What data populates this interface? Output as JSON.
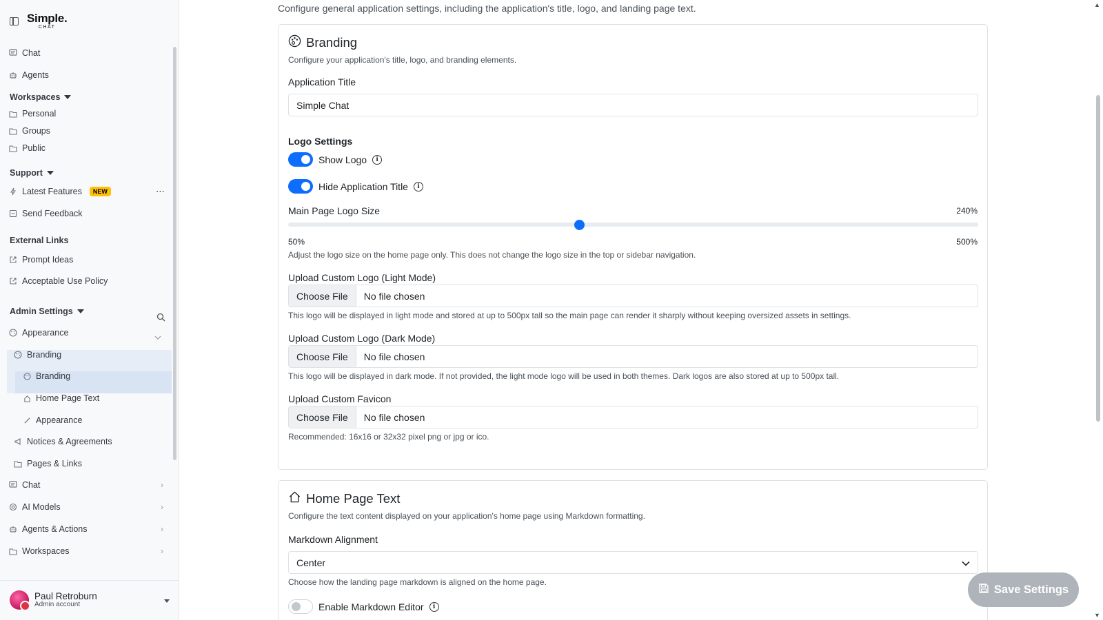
{
  "app": {
    "logo_line1": "Simple.",
    "logo_line2": "CHAT"
  },
  "sidebar": {
    "chat": "Chat",
    "agents": "Agents",
    "workspaces_header": "Workspaces",
    "personal": "Personal",
    "groups": "Groups",
    "public": "Public",
    "support_header": "Support",
    "latest_features": "Latest Features",
    "new_badge": "NEW",
    "more": "⋯",
    "send_feedback": "Send Feedback",
    "external_header": "External Links",
    "prompt_ideas": "Prompt Ideas",
    "aup": "Acceptable Use Policy",
    "admin_header": "Admin Settings",
    "appearance": "Appearance",
    "branding_group": "Branding",
    "branding_item": "Branding",
    "home_page_text": "Home Page Text",
    "appearance_item": "Appearance",
    "notices": "Notices & Agreements",
    "pages_links": "Pages & Links",
    "chat2": "Chat",
    "ai_models": "AI Models",
    "agents_actions": "Agents & Actions",
    "workspaces2": "Workspaces"
  },
  "user": {
    "name": "Paul Retroburn",
    "role": "Admin account"
  },
  "main": {
    "intro": "Configure general application settings, including the application's title, logo, and landing page text.",
    "branding": {
      "title": "Branding",
      "desc": "Configure your application's title, logo, and branding elements.",
      "app_title_label": "Application Title",
      "app_title_value": "Simple Chat",
      "logo_settings": "Logo Settings",
      "show_logo": "Show Logo",
      "show_logo_on": true,
      "hide_title": "Hide Application Title",
      "hide_title_on": true,
      "logo_size_label": "Main Page Logo Size",
      "logo_size_value": "240%",
      "logo_size_pct": 240,
      "logo_size_min": "50%",
      "logo_size_max": "500%",
      "logo_size_help": "Adjust the logo size on the home page only. This does not change the logo size in the top or sidebar navigation.",
      "light_label": "Upload Custom Logo (Light Mode)",
      "choose_file": "Choose File",
      "no_file": "No file chosen",
      "light_help": "This logo will be displayed in light mode and stored at up to 500px tall so the main page can render it sharply without keeping oversized assets in settings.",
      "dark_label": "Upload Custom Logo (Dark Mode)",
      "dark_help": "This logo will be displayed in dark mode. If not provided, the light mode logo will be used in both themes. Dark logos are also stored at up to 500px tall.",
      "favicon_label": "Upload Custom Favicon",
      "favicon_help": "Recommended: 16x16 or 32x32 pixel png or jpg or ico."
    },
    "home": {
      "title": "Home Page Text",
      "desc": "Configure the text content displayed on your application's home page using Markdown formatting.",
      "align_label": "Markdown Alignment",
      "align_value": "Center",
      "align_help": "Choose how the landing page markdown is aligned on the home page.",
      "editor_label": "Enable Markdown Editor",
      "editor_on": false
    },
    "save": "Save Settings"
  },
  "colors": {
    "accent": "#0d6efd",
    "badge": "#ffc107",
    "save_bg": "#aeb4ba"
  }
}
